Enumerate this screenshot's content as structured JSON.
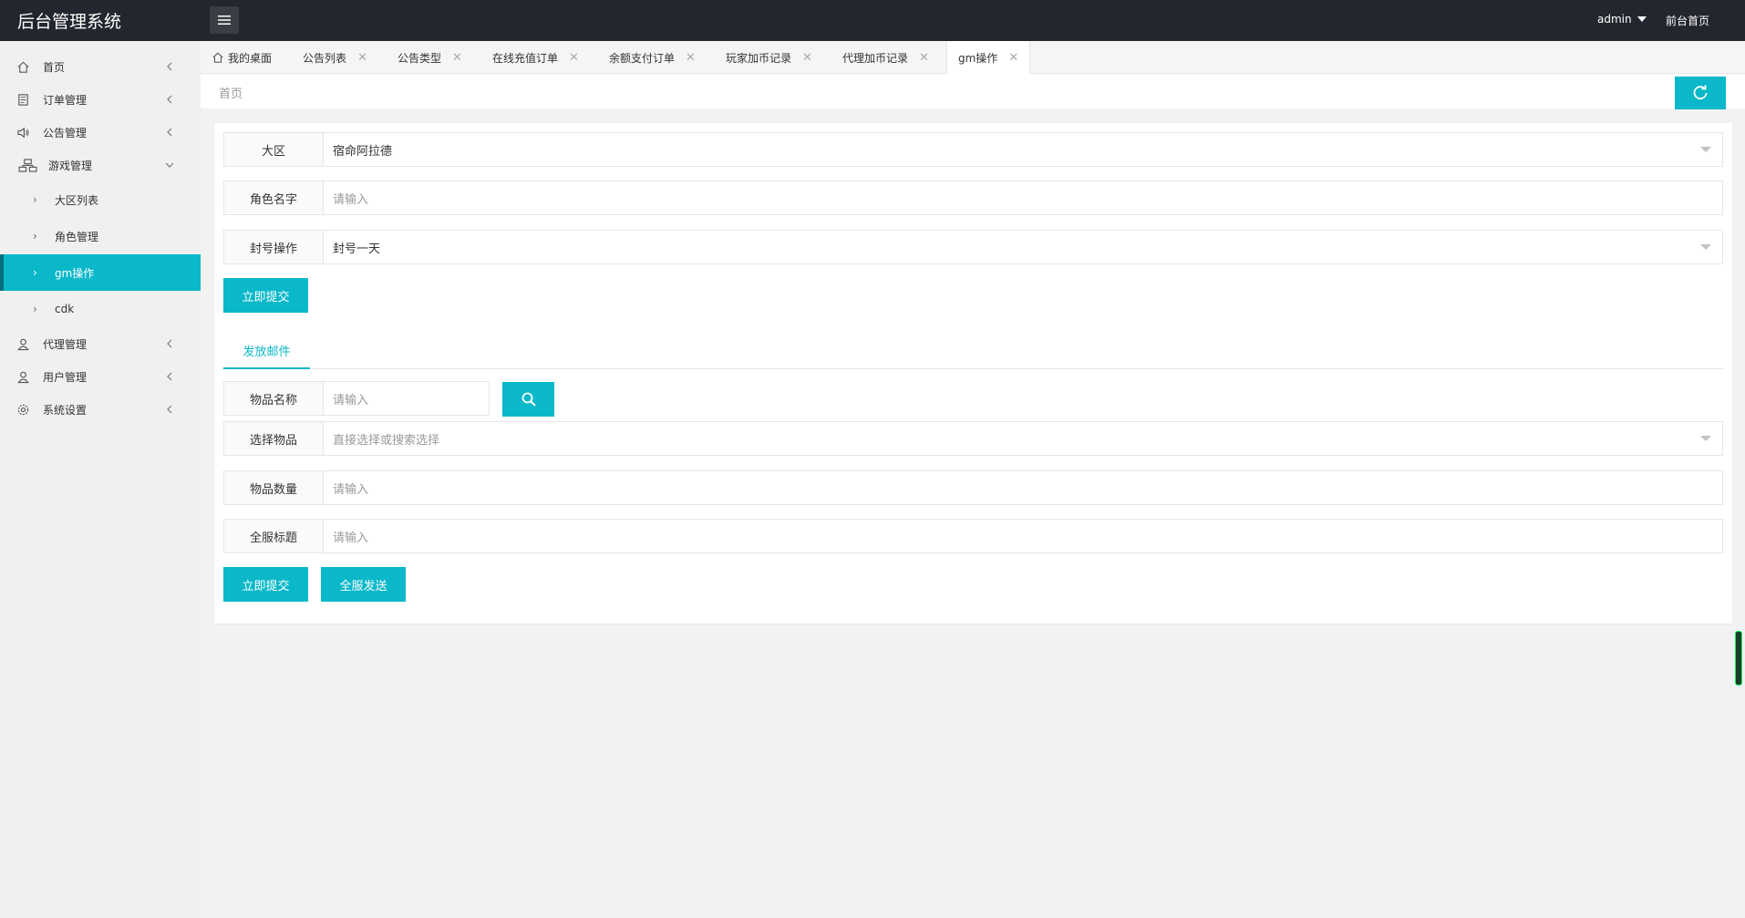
{
  "header": {
    "title": "后台管理系统",
    "user": "admin",
    "front_link": "前台首页"
  },
  "sidebar": {
    "items": [
      {
        "label": "首页",
        "icon": "home-icon"
      },
      {
        "label": "订单管理",
        "icon": "document-icon"
      },
      {
        "label": "公告管理",
        "icon": "speaker-icon"
      },
      {
        "label": "游戏管理",
        "icon": "sitemap-icon"
      },
      {
        "label": "代理管理",
        "icon": "user-icon"
      },
      {
        "label": "用户管理",
        "icon": "user-icon"
      },
      {
        "label": "系统设置",
        "icon": "gear-icon"
      }
    ],
    "sub_items": [
      {
        "label": "大区列表"
      },
      {
        "label": "角色管理"
      },
      {
        "label": "gm操作",
        "active": true
      },
      {
        "label": "cdk"
      }
    ]
  },
  "tabs": [
    {
      "label": "我的桌面"
    },
    {
      "label": "公告列表"
    },
    {
      "label": "公告类型"
    },
    {
      "label": "在线充值订单"
    },
    {
      "label": "余额支付订单"
    },
    {
      "label": "玩家加币记录"
    },
    {
      "label": "代理加币记录"
    },
    {
      "label": "gm操作",
      "active": true
    }
  ],
  "breadcrumb": "首页",
  "form1": {
    "region_label": "大区",
    "region_value": "宿命阿拉德",
    "role_label": "角色名字",
    "role_placeholder": "请输入",
    "ban_label": "封号操作",
    "ban_value": "封号一天",
    "submit": "立即提交"
  },
  "mail_tab": "发放邮件",
  "form2": {
    "item_name_label": "物品名称",
    "item_name_placeholder": "请输入",
    "select_item_label": "选择物品",
    "select_item_placeholder": "直接选择或搜索选择",
    "qty_label": "物品数量",
    "qty_placeholder": "请输入",
    "title_label": "全服标题",
    "title_placeholder": "请输入",
    "submit": "立即提交",
    "send_all": "全服发送"
  },
  "colors": {
    "accent": "#0ab8c9",
    "header_bg": "#23262e"
  }
}
